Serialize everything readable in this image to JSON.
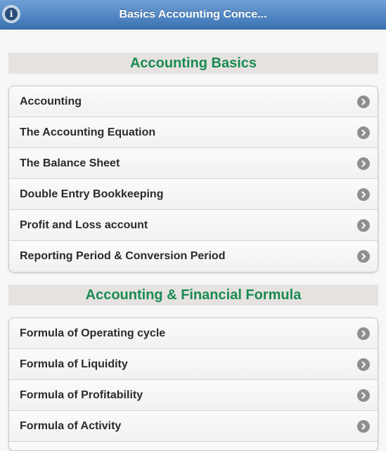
{
  "header": {
    "title": "Basics Accounting Conce...",
    "info_icon": "info-icon"
  },
  "sections": [
    {
      "title": "Accounting Basics",
      "items": [
        {
          "label": "Accounting"
        },
        {
          "label": "The Accounting Equation"
        },
        {
          "label": "The Balance Sheet"
        },
        {
          "label": "Double Entry Bookkeeping"
        },
        {
          "label": "Profit and Loss account"
        },
        {
          "label": "Reporting Period & Conversion Period"
        }
      ]
    },
    {
      "title": "Accounting & Financial Formula",
      "items": [
        {
          "label": "Formula of Operating cycle"
        },
        {
          "label": "Formula of Liquidity"
        },
        {
          "label": "Formula of Profitability"
        },
        {
          "label": "Formula of Activity"
        },
        {
          "label": ""
        }
      ]
    }
  ],
  "colors": {
    "header": "#4a80c0",
    "section_title": "#1a8a52",
    "section_bg": "#e5e2e0",
    "arrow": "#8f8f8f"
  }
}
